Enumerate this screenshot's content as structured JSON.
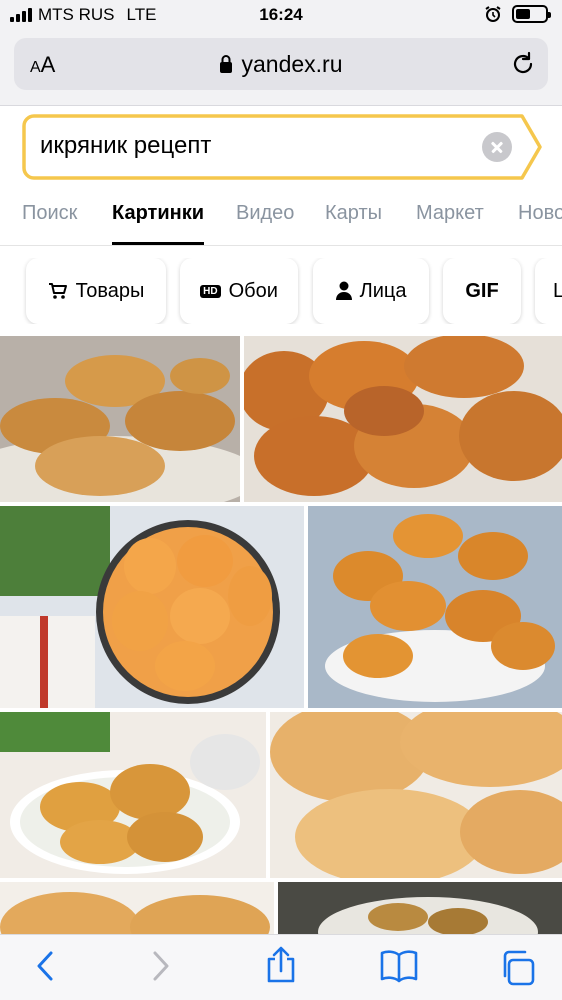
{
  "status_bar": {
    "carrier": "MTS RUS",
    "network": "LTE",
    "time": "16:24",
    "battery_level": 0.5
  },
  "browser": {
    "aa_label": "AA",
    "domain": "yandex.ru"
  },
  "search": {
    "query": "икряник рецепт"
  },
  "tabs": [
    {
      "label": "Поиск",
      "active": false
    },
    {
      "label": "Картинки",
      "active": true
    },
    {
      "label": "Видео",
      "active": false
    },
    {
      "label": "Карты",
      "active": false
    },
    {
      "label": "Маркет",
      "active": false
    },
    {
      "label": "Новости",
      "active": false
    }
  ],
  "chips": [
    {
      "label": "Товары",
      "icon": "cart-icon"
    },
    {
      "label": "Обои",
      "icon": "hd-icon",
      "badge": "HD"
    },
    {
      "label": "Лица",
      "icon": "person-icon"
    },
    {
      "label": "GIF"
    },
    {
      "label": "L"
    }
  ],
  "images": [
    {
      "name": "fritters-on-plate-1",
      "icon": "photo"
    },
    {
      "name": "fritters-on-plate-2",
      "icon": "photo"
    },
    {
      "name": "fritters-with-greens",
      "icon": "photo"
    },
    {
      "name": "fritters-pile",
      "icon": "photo"
    },
    {
      "name": "fritters-with-onion",
      "icon": "photo"
    },
    {
      "name": "fritters-closeup",
      "icon": "photo"
    },
    {
      "name": "fritters-partial-1",
      "icon": "photo"
    },
    {
      "name": "fritters-partial-2",
      "icon": "photo"
    }
  ],
  "toolbar": {
    "icons": [
      "back-icon",
      "forward-icon",
      "share-icon",
      "bookmarks-icon",
      "tabs-icon"
    ]
  },
  "colors": {
    "search_border": "#f5c74d",
    "tab_inactive": "#8a94a0",
    "toolbar_accent": "#1a73e8"
  }
}
